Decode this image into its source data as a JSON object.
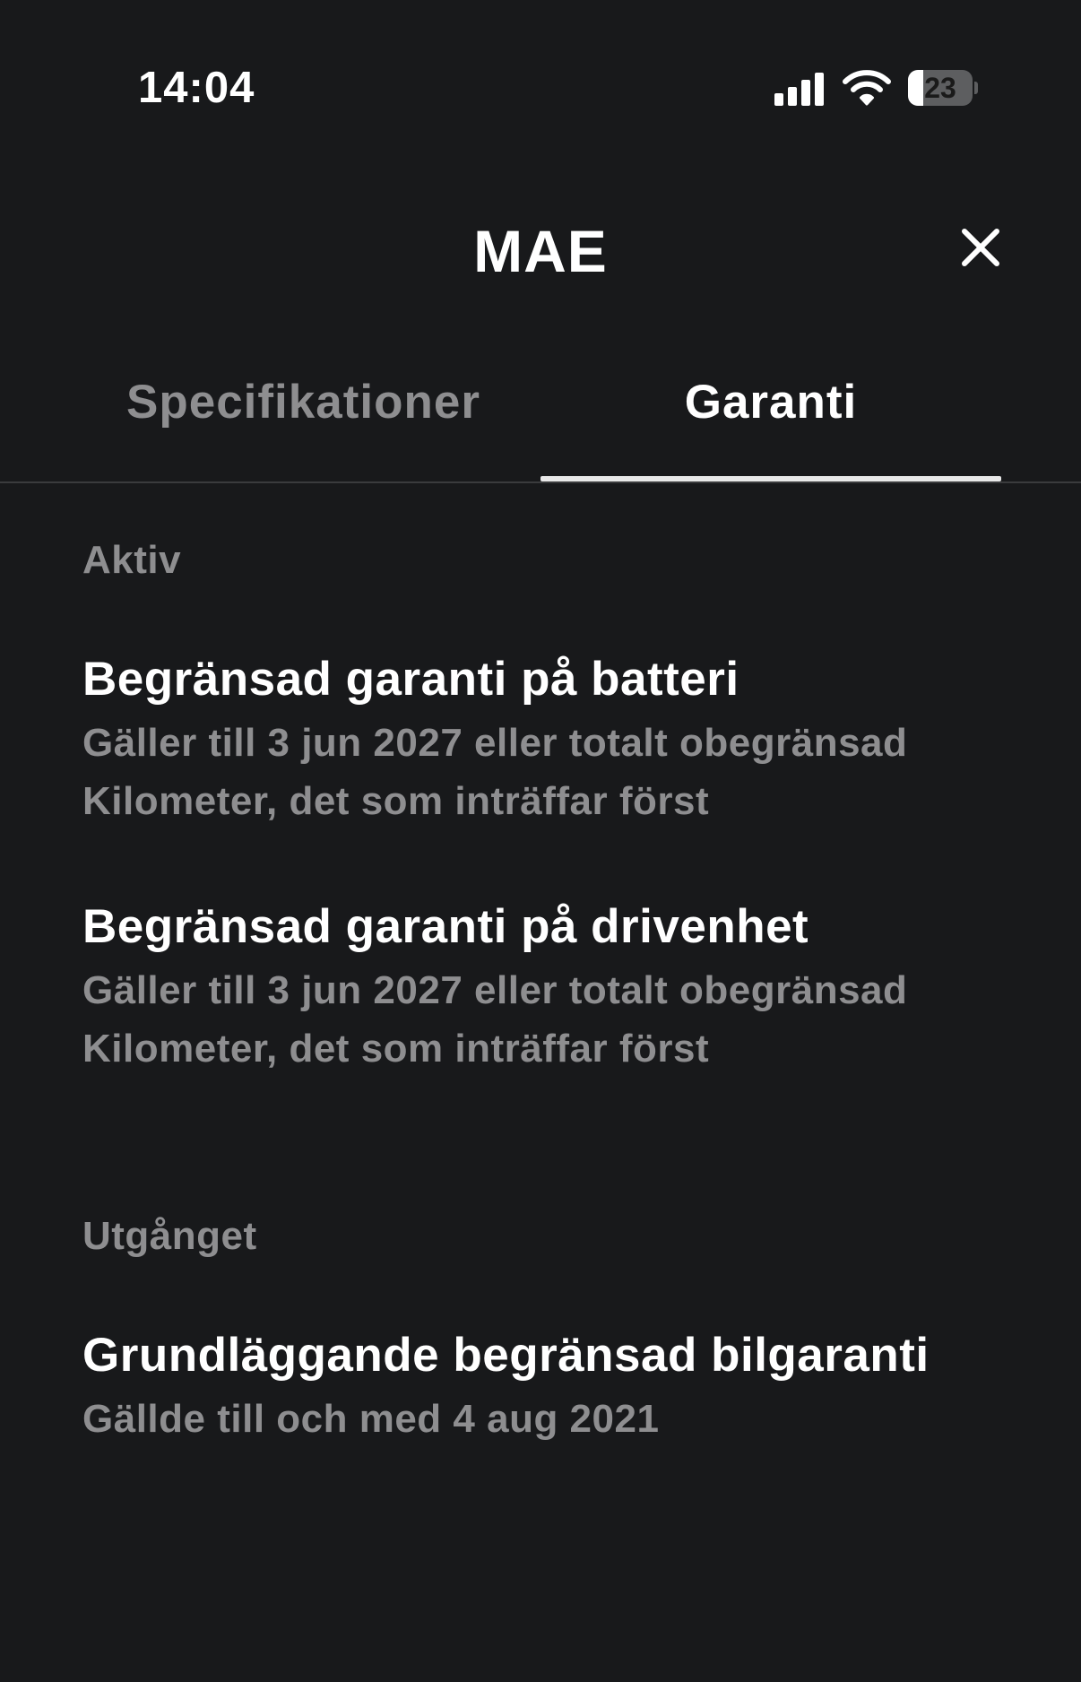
{
  "status_bar": {
    "time": "14:04",
    "battery_level": "23",
    "battery_fraction": 0.23,
    "icons": [
      "signal-icon",
      "wifi-icon",
      "battery-icon"
    ]
  },
  "header": {
    "title": "MAE",
    "close_icon": "close-icon"
  },
  "tabs": [
    {
      "label": "Specifikationer",
      "active": false
    },
    {
      "label": "Garanti",
      "active": true
    }
  ],
  "sections": [
    {
      "heading": "Aktiv",
      "items": [
        {
          "title": "Begränsad garanti på batteri",
          "description": "Gäller till 3 jun 2027 eller totalt obegränsad Kilometer, det som inträffar först"
        },
        {
          "title": "Begränsad garanti på drivenhet",
          "description": "Gäller till 3 jun 2027 eller totalt obegränsad Kilometer, det som inträffar först"
        }
      ]
    },
    {
      "heading": "Utgånget",
      "items": [
        {
          "title": "Grundläggande begränsad bilgaranti",
          "description": "Gällde till och med 4 aug 2021"
        }
      ]
    }
  ],
  "colors": {
    "background": "#18191b",
    "text_primary": "#ffffff",
    "text_secondary": "#8e8e90",
    "tab_underline": "#e8e8e8",
    "divider": "#3a3b3d"
  }
}
